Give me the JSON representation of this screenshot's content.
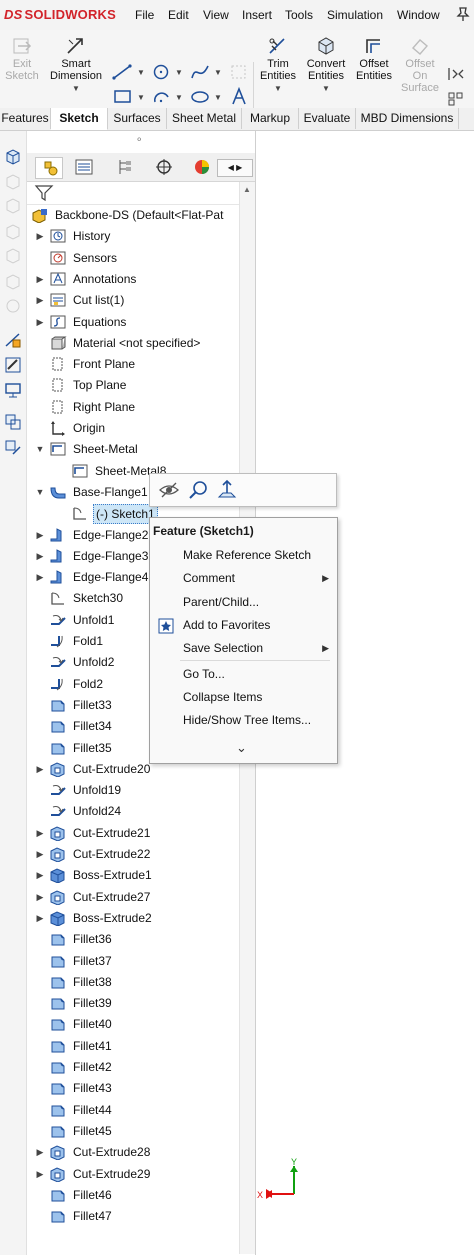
{
  "app": {
    "logo_text": "SOLIDWORKS",
    "logo_mark": "DS"
  },
  "menu": [
    "File",
    "Edit",
    "View",
    "Insert",
    "Tools",
    "Simulation",
    "Window"
  ],
  "ribbon": {
    "exit_sketch": "Exit\nSketch",
    "smart_dimension": "Smart\nDimension",
    "trim_entities": "Trim\nEntities",
    "convert_entities": "Convert\nEntities",
    "offset_entities": "Offset\nEntities",
    "offset_on_surface": "Offset\nOn\nSurface"
  },
  "tabs": [
    "Features",
    "Sketch",
    "Surfaces",
    "Sheet Metal",
    "Markup",
    "Evaluate",
    "MBD Dimensions"
  ],
  "active_tab": "Sketch",
  "tree": [
    {
      "label": "Backbone-DS (Default<Flat-Pat",
      "level": 0,
      "expander": "",
      "icon": "part-icon"
    },
    {
      "label": "History",
      "level": 1,
      "expander": "▶",
      "icon": "history-icon"
    },
    {
      "label": "Sensors",
      "level": 1,
      "expander": "",
      "icon": "sensors-icon"
    },
    {
      "label": "Annotations",
      "level": 1,
      "expander": "▶",
      "icon": "annotations-icon"
    },
    {
      "label": "Cut list(1)",
      "level": 1,
      "expander": "▶",
      "icon": "cut-list-icon"
    },
    {
      "label": "Equations",
      "level": 1,
      "expander": "▶",
      "icon": "equations-icon"
    },
    {
      "label": "Material <not specified>",
      "level": 1,
      "expander": "",
      "icon": "material-icon"
    },
    {
      "label": "Front Plane",
      "level": 1,
      "expander": "",
      "icon": "plane-icon"
    },
    {
      "label": "Top Plane",
      "level": 1,
      "expander": "",
      "icon": "plane-icon"
    },
    {
      "label": "Right Plane",
      "level": 1,
      "expander": "",
      "icon": "plane-icon"
    },
    {
      "label": "Origin",
      "level": 1,
      "expander": "",
      "icon": "origin-icon"
    },
    {
      "label": "Sheet-Metal",
      "level": 1,
      "expander": "▼",
      "icon": "sheet-metal-icon"
    },
    {
      "label": "Sheet-Metal8",
      "level": 2,
      "expander": "",
      "icon": "sheet-metal-icon"
    },
    {
      "label": "Base-Flange1",
      "level": 1,
      "expander": "▼",
      "icon": "flange-icon"
    },
    {
      "label": "(-) Sketch1",
      "level": 2,
      "expander": "",
      "icon": "sketch-icon",
      "selected": true
    },
    {
      "label": "Edge-Flange2",
      "level": 1,
      "expander": "▶",
      "icon": "edge-flange-icon"
    },
    {
      "label": "Edge-Flange3",
      "level": 1,
      "expander": "▶",
      "icon": "edge-flange-icon"
    },
    {
      "label": "Edge-Flange4",
      "level": 1,
      "expander": "▶",
      "icon": "edge-flange-icon"
    },
    {
      "label": "Sketch30",
      "level": 1,
      "expander": "",
      "icon": "sketch-icon"
    },
    {
      "label": "Unfold1",
      "level": 1,
      "expander": "",
      "icon": "unfold-icon"
    },
    {
      "label": "Fold1",
      "level": 1,
      "expander": "",
      "icon": "fold-icon"
    },
    {
      "label": "Unfold2",
      "level": 1,
      "expander": "",
      "icon": "unfold-icon"
    },
    {
      "label": "Fold2",
      "level": 1,
      "expander": "",
      "icon": "fold-icon"
    },
    {
      "label": "Fillet33",
      "level": 1,
      "expander": "",
      "icon": "fillet-icon"
    },
    {
      "label": "Fillet34",
      "level": 1,
      "expander": "",
      "icon": "fillet-icon"
    },
    {
      "label": "Fillet35",
      "level": 1,
      "expander": "",
      "icon": "fillet-icon"
    },
    {
      "label": "Cut-Extrude20",
      "level": 1,
      "expander": "▶",
      "icon": "cut-extrude-icon"
    },
    {
      "label": "Unfold19",
      "level": 1,
      "expander": "",
      "icon": "unfold-icon"
    },
    {
      "label": "Unfold24",
      "level": 1,
      "expander": "",
      "icon": "unfold-icon"
    },
    {
      "label": "Cut-Extrude21",
      "level": 1,
      "expander": "▶",
      "icon": "cut-extrude-icon"
    },
    {
      "label": "Cut-Extrude22",
      "level": 1,
      "expander": "▶",
      "icon": "cut-extrude-icon"
    },
    {
      "label": "Boss-Extrude1",
      "level": 1,
      "expander": "▶",
      "icon": "boss-extrude-icon"
    },
    {
      "label": "Cut-Extrude27",
      "level": 1,
      "expander": "▶",
      "icon": "cut-extrude-icon"
    },
    {
      "label": "Boss-Extrude2",
      "level": 1,
      "expander": "▶",
      "icon": "boss-extrude-icon"
    },
    {
      "label": "Fillet36",
      "level": 1,
      "expander": "",
      "icon": "fillet-icon"
    },
    {
      "label": "Fillet37",
      "level": 1,
      "expander": "",
      "icon": "fillet-icon"
    },
    {
      "label": "Fillet38",
      "level": 1,
      "expander": "",
      "icon": "fillet-icon"
    },
    {
      "label": "Fillet39",
      "level": 1,
      "expander": "",
      "icon": "fillet-icon"
    },
    {
      "label": "Fillet40",
      "level": 1,
      "expander": "",
      "icon": "fillet-icon"
    },
    {
      "label": "Fillet41",
      "level": 1,
      "expander": "",
      "icon": "fillet-icon"
    },
    {
      "label": "Fillet42",
      "level": 1,
      "expander": "",
      "icon": "fillet-icon"
    },
    {
      "label": "Fillet43",
      "level": 1,
      "expander": "",
      "icon": "fillet-icon"
    },
    {
      "label": "Fillet44",
      "level": 1,
      "expander": "",
      "icon": "fillet-icon"
    },
    {
      "label": "Fillet45",
      "level": 1,
      "expander": "",
      "icon": "fillet-icon"
    },
    {
      "label": "Cut-Extrude28",
      "level": 1,
      "expander": "▶",
      "icon": "cut-extrude-icon"
    },
    {
      "label": "Cut-Extrude29",
      "level": 1,
      "expander": "▶",
      "icon": "cut-extrude-icon"
    },
    {
      "label": "Fillet46",
      "level": 1,
      "expander": "",
      "icon": "fillet-icon"
    },
    {
      "label": "Fillet47",
      "level": 1,
      "expander": "",
      "icon": "fillet-icon"
    }
  ],
  "context_menu": {
    "header": "Feature (Sketch1)",
    "items": [
      {
        "label": "Make Reference Sketch",
        "submenu": false,
        "icon": ""
      },
      {
        "label": "Comment",
        "submenu": true,
        "icon": ""
      },
      {
        "label": "Parent/Child...",
        "submenu": false,
        "icon": ""
      },
      {
        "label": "Add to Favorites",
        "submenu": false,
        "icon": "favorites-icon"
      },
      {
        "label": "Save Selection",
        "submenu": true,
        "icon": ""
      },
      {
        "label": "Go To...",
        "submenu": false,
        "icon": ""
      },
      {
        "label": "Collapse Items",
        "submenu": false,
        "icon": ""
      },
      {
        "label": "Hide/Show Tree Items...",
        "submenu": false,
        "icon": ""
      }
    ],
    "more": "⌄"
  },
  "triad": {
    "x_label": "X",
    "y_label": "Y"
  },
  "colors": {
    "brand": "#d2232a",
    "selection": "#cde6f7",
    "axis_x": "#e01010",
    "axis_y": "#10a010"
  }
}
